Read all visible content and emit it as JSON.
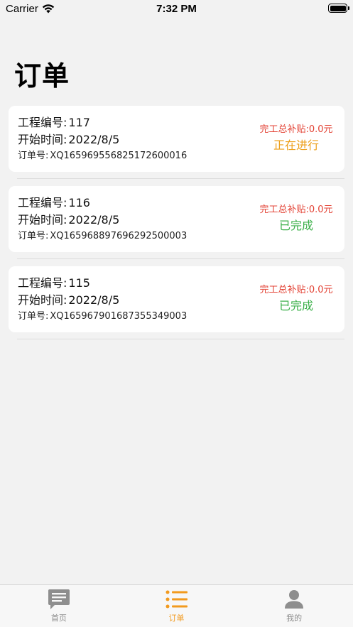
{
  "status_bar": {
    "carrier": "Carrier",
    "time": "7:32 PM"
  },
  "page": {
    "title": "订单"
  },
  "labels": {
    "project_no": "工程编号:",
    "start_time": "开始时间:",
    "order_no": "订单号:"
  },
  "orders": [
    {
      "project_no": "117",
      "start_time": "2022/8/5",
      "order_no": "XQ16596955682517260000 16",
      "order_no_text": "XQ165969556825172600016",
      "subsidy": "完工总补贴:0.0元",
      "status": "正在进行"
    },
    {
      "project_no": "116",
      "start_time": "2022/8/5",
      "order_no_text": "XQ165968897696292500003",
      "subsidy": "完工总补贴:0.0元",
      "status": "已完成"
    },
    {
      "project_no": "115",
      "start_time": "2022/8/5",
      "order_no_text": "XQ165967901687355349003",
      "subsidy": "完工总补贴:0.0元",
      "status": "已完成"
    }
  ],
  "tab_bar": {
    "items": [
      {
        "label": "首页",
        "icon": "message-icon"
      },
      {
        "label": "订单",
        "icon": "list-icon"
      },
      {
        "label": "我的",
        "icon": "person-icon"
      }
    ],
    "active_index": 1
  },
  "colors": {
    "accent": "#f29a1e",
    "subsidy": "#e34234",
    "ongoing": "#eda01c",
    "done": "#3cb04a",
    "inactive": "#8e8e8e"
  }
}
